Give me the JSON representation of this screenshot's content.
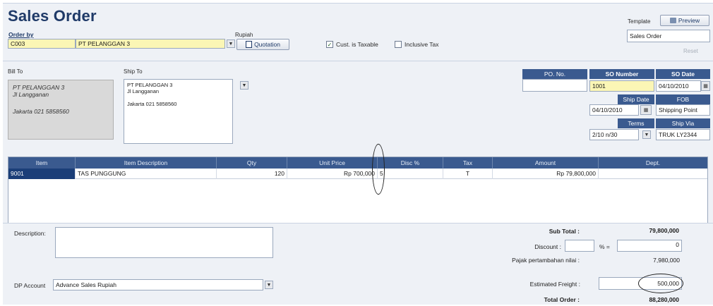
{
  "header": {
    "title": "Sales Order",
    "order_by_label": "Order by",
    "currency_label": "Rupiah",
    "customer_code": "C003",
    "customer_name": "PT PELANGGAN 3",
    "quotation_label": "Quotation",
    "cust_taxable_label": "Cust. is Taxable",
    "inclusive_tax_label": "Inclusive Tax",
    "template_label": "Template",
    "preview_label": "Preview",
    "template_value": "Sales Order",
    "reset_label": "Reset"
  },
  "bill_to": {
    "label": "Bill To",
    "lines": [
      "PT PELANGGAN 3",
      "Jl Langganan",
      "",
      "Jakarta 021 5858560"
    ]
  },
  "ship_to": {
    "label": "Ship To",
    "lines": [
      "PT PELANGGAN 3",
      "Jl Langganan",
      "",
      "Jakarta 021 5858560"
    ]
  },
  "order_info": {
    "po_no_label": "PO. No.",
    "po_no_value": "",
    "so_number_label": "SO Number",
    "so_number_value": "1001",
    "so_date_label": "SO Date",
    "so_date_value": "04/10/2010",
    "ship_date_label": "Ship Date",
    "ship_date_value": "04/10/2010",
    "fob_label": "FOB",
    "fob_value": "Shipping Point",
    "terms_label": "Terms",
    "terms_value": "2/10 n/30",
    "ship_via_label": "Ship Via",
    "ship_via_value": "TRUK LY2344"
  },
  "grid": {
    "columns": [
      "Item",
      "Item Description",
      "Qty",
      "Unit Price",
      "Disc %",
      "Tax",
      "Amount",
      "Dept."
    ],
    "rows": [
      {
        "item": "9001",
        "description": "TAS PUNGGUNG",
        "qty": "120",
        "unit_price": "Rp 700,000",
        "disc": "5",
        "tax": "T",
        "amount": "Rp 79,800,000",
        "dept": ""
      }
    ]
  },
  "footer": {
    "description_label": "Description:",
    "description_value": "",
    "dp_account_label": "DP Account",
    "dp_account_value": "Advance Sales Rupiah",
    "sub_total_label": "Sub Total :",
    "sub_total_value": "79,800,000",
    "discount_label": "Discount :",
    "discount_pct_value": "",
    "discount_pct_sign": "% =",
    "discount_value": "0",
    "ppn_label": "Pajak pertambahan nilai :",
    "ppn_value": "7,980,000",
    "freight_label": "Estimated Freight :",
    "freight_value": "500,000",
    "total_label": "Total Order :",
    "total_value": "88,280,000"
  },
  "colors": {
    "header_blue": "#3a5a8f",
    "title_blue": "#1f3a68",
    "field_yellow": "#fbf6b5",
    "selected_cell": "#1b3e78"
  }
}
